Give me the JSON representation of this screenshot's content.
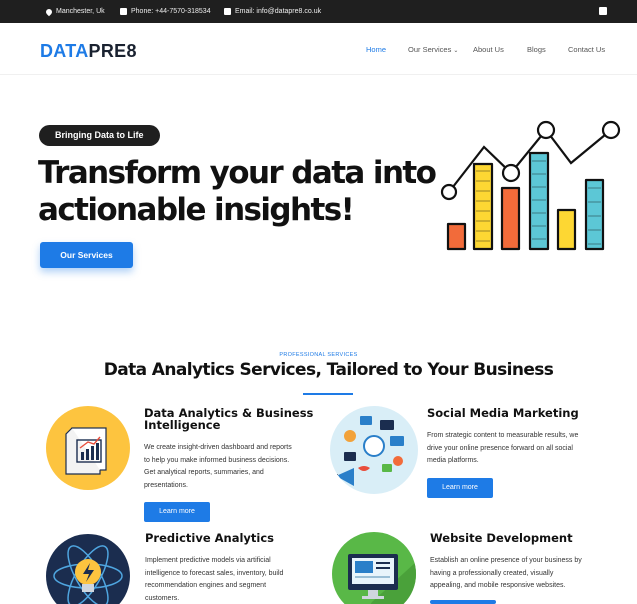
{
  "topbar": {
    "location": "Manchester, Uk",
    "phone": "Phone: +44-7570-318534",
    "email": "Email: info@datapre8.co.uk"
  },
  "brand": {
    "part1": "DATA",
    "part2": "PRE8"
  },
  "nav": {
    "items": [
      "Home",
      "Our Services",
      "About Us",
      "Blogs",
      "Contact Us"
    ],
    "active": "Home",
    "dropdown_indicator": "⌄"
  },
  "hero": {
    "pill": "Bringing Data to Life",
    "headline_line1": "Transform your data into",
    "headline_line2": "actionable insights!",
    "cta": "Our Services"
  },
  "services_section": {
    "eyebrow": "PROFESSIONAL SERVICES",
    "title": "Data Analytics Services, Tailored to Your Business"
  },
  "services": [
    {
      "title_line1": "Data Analytics & Business",
      "title_line2": "Intelligence",
      "desc_lines": [
        "We create insight-driven dashboard and reports",
        "to help you make informed business decisions.",
        "Get analytical reports, summaries, and",
        "presentations."
      ],
      "button": "Learn more",
      "icon": "report-chart-icon"
    },
    {
      "title_line1": "Social Media Marketing",
      "desc_lines": [
        "From strategic content to measurable results, we",
        "drive your online presence forward on all social",
        "media platforms."
      ],
      "button": "Learn more",
      "icon": "megaphone-social-icon"
    },
    {
      "title_line1": "Predictive Analytics",
      "desc_lines": [
        "Implement predictive models via artificial",
        "intelligence to forecast sales, inventory, build",
        "recommendation engines and segment",
        "customers."
      ],
      "icon": "atom-bulb-icon"
    },
    {
      "title_line1": "Website Development",
      "desc_lines": [
        "Establish an online presence of your business by",
        "having a  professionally created, visually",
        "appealing, and mobile responsive websites."
      ],
      "icon": "monitor-web-icon"
    }
  ],
  "colors": {
    "accent": "#1e7be6",
    "dark": "#1f1f1f",
    "icon_yellow": "#fdc43f",
    "icon_green": "#59b847",
    "icon_navy": "#1b2d4f",
    "icon_lightblue": "#d9eef7"
  }
}
